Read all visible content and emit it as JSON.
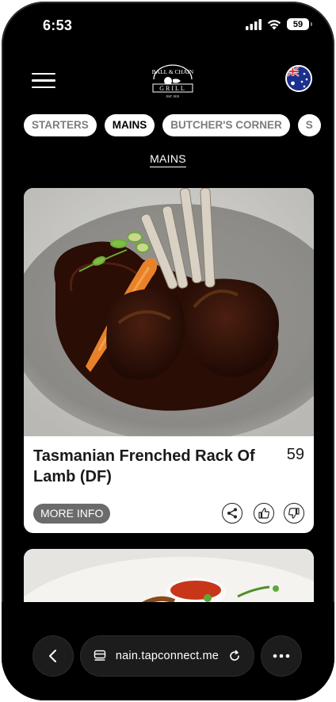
{
  "status_bar": {
    "time": "6:53",
    "battery": "59"
  },
  "header": {
    "logo_text_top": "BALL & CHAIN",
    "logo_text_bottom": "GRILL",
    "logo_est": "EST 1919"
  },
  "tabs": [
    {
      "label": "STARTERS",
      "active": false
    },
    {
      "label": "MAINS",
      "active": true
    },
    {
      "label": "BUTCHER'S CORNER",
      "active": false
    },
    {
      "label": "S",
      "active": false
    }
  ],
  "section_title": "MAINS",
  "menu_item": {
    "name": "Tasmanian Frenched Rack Of Lamb (DF)",
    "price": "59",
    "more_info_label": "MORE INFO"
  },
  "browser": {
    "url": "nain.tapconnect.me"
  },
  "icons": [
    "hamburger-menu-icon",
    "australia-flag-icon",
    "share-icon",
    "thumbs-up-icon",
    "thumbs-down-icon",
    "back-icon",
    "tabs-icon",
    "reload-icon",
    "more-icon"
  ],
  "colors": {
    "background": "#000000",
    "card": "#ffffff",
    "more_info_button": "#6b6b6b",
    "tab_inactive_text": "#7d7d7d"
  }
}
